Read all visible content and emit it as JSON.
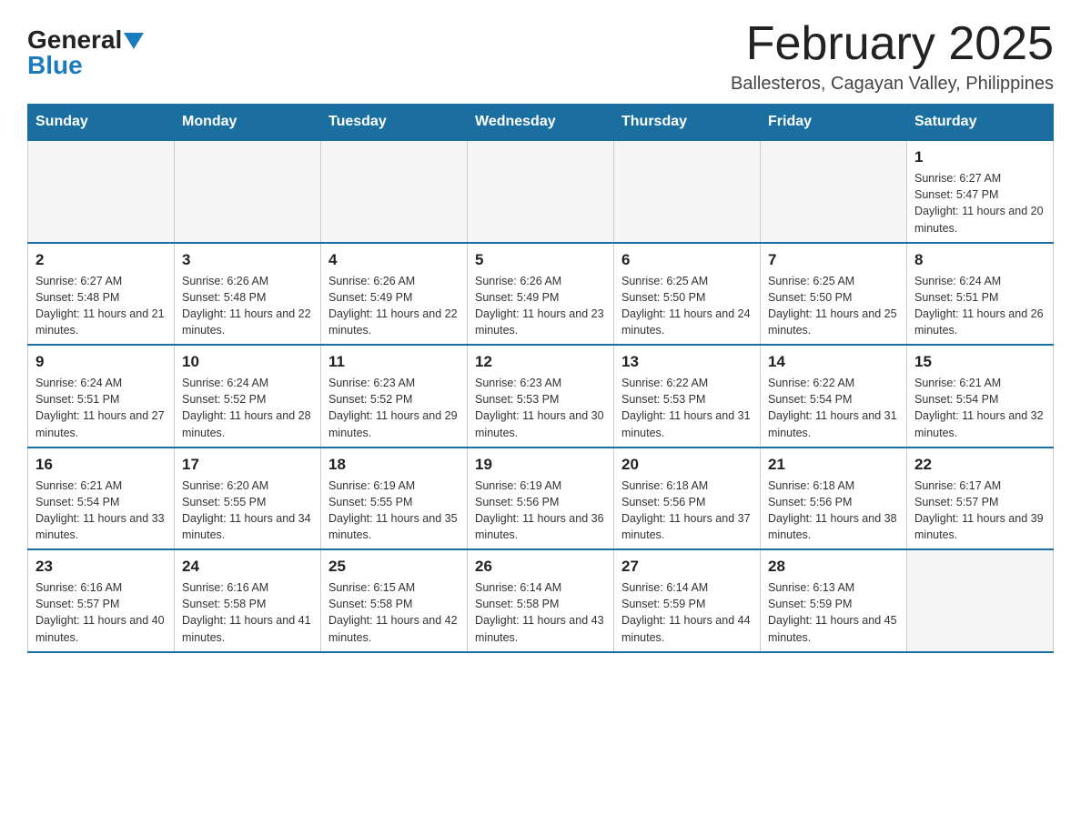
{
  "header": {
    "logo": {
      "general": "General",
      "blue": "Blue",
      "arrow": "▲"
    },
    "title": "February 2025",
    "subtitle": "Ballesteros, Cagayan Valley, Philippines"
  },
  "days_of_week": [
    "Sunday",
    "Monday",
    "Tuesday",
    "Wednesday",
    "Thursday",
    "Friday",
    "Saturday"
  ],
  "weeks": [
    [
      {
        "day": "",
        "info": ""
      },
      {
        "day": "",
        "info": ""
      },
      {
        "day": "",
        "info": ""
      },
      {
        "day": "",
        "info": ""
      },
      {
        "day": "",
        "info": ""
      },
      {
        "day": "",
        "info": ""
      },
      {
        "day": "1",
        "info": "Sunrise: 6:27 AM\nSunset: 5:47 PM\nDaylight: 11 hours and 20 minutes."
      }
    ],
    [
      {
        "day": "2",
        "info": "Sunrise: 6:27 AM\nSunset: 5:48 PM\nDaylight: 11 hours and 21 minutes."
      },
      {
        "day": "3",
        "info": "Sunrise: 6:26 AM\nSunset: 5:48 PM\nDaylight: 11 hours and 22 minutes."
      },
      {
        "day": "4",
        "info": "Sunrise: 6:26 AM\nSunset: 5:49 PM\nDaylight: 11 hours and 22 minutes."
      },
      {
        "day": "5",
        "info": "Sunrise: 6:26 AM\nSunset: 5:49 PM\nDaylight: 11 hours and 23 minutes."
      },
      {
        "day": "6",
        "info": "Sunrise: 6:25 AM\nSunset: 5:50 PM\nDaylight: 11 hours and 24 minutes."
      },
      {
        "day": "7",
        "info": "Sunrise: 6:25 AM\nSunset: 5:50 PM\nDaylight: 11 hours and 25 minutes."
      },
      {
        "day": "8",
        "info": "Sunrise: 6:24 AM\nSunset: 5:51 PM\nDaylight: 11 hours and 26 minutes."
      }
    ],
    [
      {
        "day": "9",
        "info": "Sunrise: 6:24 AM\nSunset: 5:51 PM\nDaylight: 11 hours and 27 minutes."
      },
      {
        "day": "10",
        "info": "Sunrise: 6:24 AM\nSunset: 5:52 PM\nDaylight: 11 hours and 28 minutes."
      },
      {
        "day": "11",
        "info": "Sunrise: 6:23 AM\nSunset: 5:52 PM\nDaylight: 11 hours and 29 minutes."
      },
      {
        "day": "12",
        "info": "Sunrise: 6:23 AM\nSunset: 5:53 PM\nDaylight: 11 hours and 30 minutes."
      },
      {
        "day": "13",
        "info": "Sunrise: 6:22 AM\nSunset: 5:53 PM\nDaylight: 11 hours and 31 minutes."
      },
      {
        "day": "14",
        "info": "Sunrise: 6:22 AM\nSunset: 5:54 PM\nDaylight: 11 hours and 31 minutes."
      },
      {
        "day": "15",
        "info": "Sunrise: 6:21 AM\nSunset: 5:54 PM\nDaylight: 11 hours and 32 minutes."
      }
    ],
    [
      {
        "day": "16",
        "info": "Sunrise: 6:21 AM\nSunset: 5:54 PM\nDaylight: 11 hours and 33 minutes."
      },
      {
        "day": "17",
        "info": "Sunrise: 6:20 AM\nSunset: 5:55 PM\nDaylight: 11 hours and 34 minutes."
      },
      {
        "day": "18",
        "info": "Sunrise: 6:19 AM\nSunset: 5:55 PM\nDaylight: 11 hours and 35 minutes."
      },
      {
        "day": "19",
        "info": "Sunrise: 6:19 AM\nSunset: 5:56 PM\nDaylight: 11 hours and 36 minutes."
      },
      {
        "day": "20",
        "info": "Sunrise: 6:18 AM\nSunset: 5:56 PM\nDaylight: 11 hours and 37 minutes."
      },
      {
        "day": "21",
        "info": "Sunrise: 6:18 AM\nSunset: 5:56 PM\nDaylight: 11 hours and 38 minutes."
      },
      {
        "day": "22",
        "info": "Sunrise: 6:17 AM\nSunset: 5:57 PM\nDaylight: 11 hours and 39 minutes."
      }
    ],
    [
      {
        "day": "23",
        "info": "Sunrise: 6:16 AM\nSunset: 5:57 PM\nDaylight: 11 hours and 40 minutes."
      },
      {
        "day": "24",
        "info": "Sunrise: 6:16 AM\nSunset: 5:58 PM\nDaylight: 11 hours and 41 minutes."
      },
      {
        "day": "25",
        "info": "Sunrise: 6:15 AM\nSunset: 5:58 PM\nDaylight: 11 hours and 42 minutes."
      },
      {
        "day": "26",
        "info": "Sunrise: 6:14 AM\nSunset: 5:58 PM\nDaylight: 11 hours and 43 minutes."
      },
      {
        "day": "27",
        "info": "Sunrise: 6:14 AM\nSunset: 5:59 PM\nDaylight: 11 hours and 44 minutes."
      },
      {
        "day": "28",
        "info": "Sunrise: 6:13 AM\nSunset: 5:59 PM\nDaylight: 11 hours and 45 minutes."
      },
      {
        "day": "",
        "info": ""
      }
    ]
  ]
}
